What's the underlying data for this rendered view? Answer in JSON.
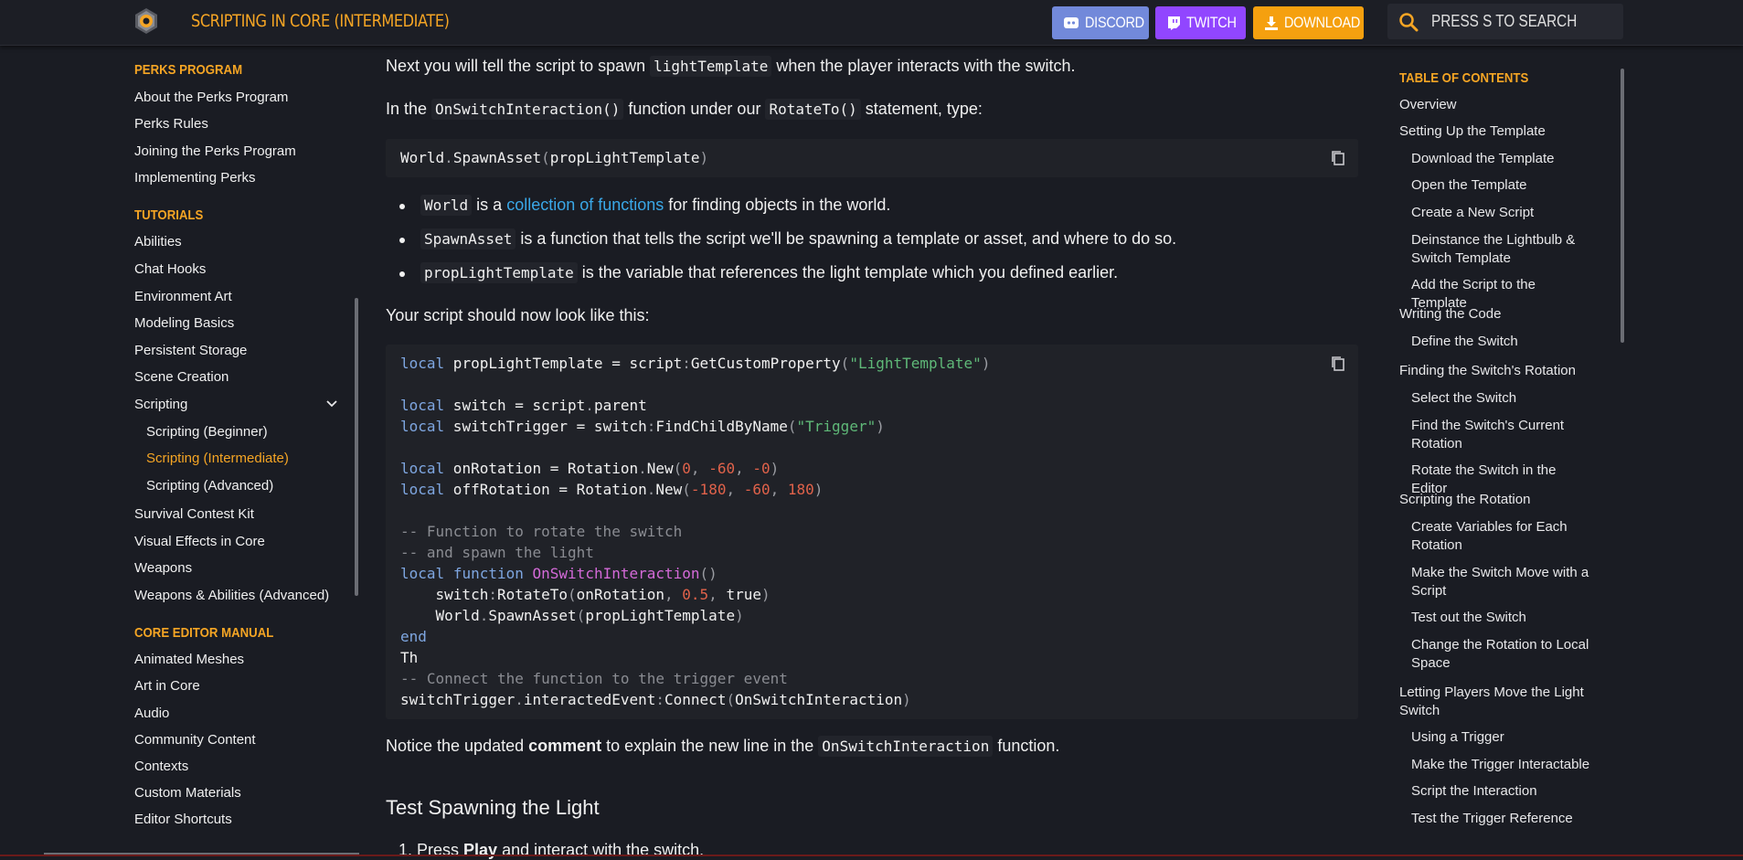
{
  "header": {
    "title": "SCRIPTING IN CORE (INTERMEDIATE)",
    "discord_label": "DISCORD",
    "twitch_label": "TWITCH",
    "download_label": "DOWNLOAD",
    "search_placeholder": "PRESS S TO SEARCH"
  },
  "colors": {
    "accent": "#f5a524",
    "discord": "#7289da",
    "twitch": "#9146ff",
    "download": "#f5a00f",
    "link": "#3aa8e8"
  },
  "sidebar": {
    "perks_heading": "PERKS PROGRAM",
    "perks_items": [
      "About the Perks Program",
      "Perks Rules",
      "Joining the Perks Program",
      "Implementing Perks"
    ],
    "tutorials_heading": "TUTORIALS",
    "tutorials_items": [
      "Abilities",
      "Chat Hooks",
      "Environment Art",
      "Modeling Basics",
      "Persistent Storage",
      "Scene Creation",
      "Scripting"
    ],
    "scripting_sub": [
      "Scripting (Beginner)",
      "Scripting (Intermediate)",
      "Scripting (Advanced)"
    ],
    "tutorials_items_after": [
      "Survival Contest Kit",
      "Visual Effects in Core",
      "Weapons",
      "Weapons & Abilities (Advanced)"
    ],
    "manual_heading": "CORE EDITOR MANUAL",
    "manual_items": [
      "Animated Meshes",
      "Art in Core",
      "Audio",
      "Community Content",
      "Contexts",
      "Custom Materials",
      "Editor Shortcuts"
    ]
  },
  "content": {
    "p1_a": "Next you will tell the script to spawn ",
    "p1_code": "lightTemplate",
    "p1_b": " when the player interacts with the switch.",
    "p2_a": "In the ",
    "p2_code1": "OnSwitchInteraction()",
    "p2_b": " function under our ",
    "p2_code2": "RotateTo()",
    "p2_c": " statement, type:",
    "code1_a": "World",
    "code1_b": ".",
    "code1_c": "SpawnAsset",
    "code1_d": "(",
    "code1_e": "propLightTemplate",
    "code1_f": ")",
    "b1_code": "World",
    "b1_a": " is a ",
    "b1_link": "collection of functions",
    "b1_b": " for finding objects in the world.",
    "b2_code": "SpawnAsset",
    "b2_a": " is a function that tells the script we'll be spawning a template or asset, and where to do so.",
    "b3_code": "propLightTemplate",
    "b3_a": " is the variable that references the light template which you defined earlier.",
    "p3": "Your script should now look like this:",
    "p4_a": "Notice the updated ",
    "p4_bold": "comment",
    "p4_b": " to explain the new line in the ",
    "p4_code": "OnSwitchInteraction",
    "p4_c": " function.",
    "h_test": "Test Spawning the Light",
    "step1_a": "1. Press ",
    "step1_bold": "Play",
    "step1_b": " and interact with the switch."
  },
  "code2": {
    "l1": [
      "local",
      " propLightTemplate = script",
      ":",
      "GetCustomProperty",
      "(",
      "\"LightTemplate\"",
      ")"
    ],
    "l3": [
      "local",
      " switch = script",
      ".",
      "parent"
    ],
    "l4": [
      "local",
      " switchTrigger = switch",
      ":",
      "FindChildByName",
      "(",
      "\"Trigger\"",
      ")"
    ],
    "l6": [
      "local",
      " onRotation = Rotation",
      ".",
      "New",
      "(",
      "0",
      ", ",
      "-60",
      ", ",
      "-0",
      ")"
    ],
    "l7": [
      "local",
      " offRotation = Rotation",
      ".",
      "New",
      "(",
      "-180",
      ", ",
      "-60",
      ", ",
      "180",
      ")"
    ],
    "l9": "-- Function to rotate the switch",
    "l10": "-- and spawn the light",
    "l11": [
      "local",
      " ",
      "function",
      " ",
      "OnSwitchInteraction",
      "()"
    ],
    "l12": [
      "    switch",
      ":",
      "RotateTo",
      "(",
      "onRotation",
      ", ",
      "0.5",
      ", ",
      "true",
      ")"
    ],
    "l13": [
      "    World",
      ".",
      "SpawnAsset",
      "(",
      "propLightTemplate",
      ")"
    ],
    "l14": "end",
    "l15": "Th",
    "l16": "-- Connect the function to the trigger event",
    "l17": [
      "switchTrigger",
      ".",
      "interactedEvent",
      ":",
      "Connect",
      "(",
      "OnSwitchInteraction",
      ")"
    ]
  },
  "toc": {
    "heading": "TABLE OF CONTENTS",
    "items": [
      {
        "label": "Overview",
        "level": 1
      },
      {
        "label": "Setting Up the Template",
        "level": 1
      },
      {
        "label": "Download the Template",
        "level": 2
      },
      {
        "label": "Open the Template",
        "level": 2
      },
      {
        "label": "Create a New Script",
        "level": 2
      },
      {
        "label": "Deinstance the Lightbulb & Switch Template",
        "level": 2
      },
      {
        "label": "Add the Script to the Template",
        "level": 2
      },
      {
        "label": "Writing the Code",
        "level": 1
      },
      {
        "label": "Define the Switch",
        "level": 2
      },
      {
        "label": "Finding the Switch's Rotation",
        "level": 1
      },
      {
        "label": "Select the Switch",
        "level": 2
      },
      {
        "label": "Find the Switch's Current Rotation",
        "level": 2
      },
      {
        "label": "Rotate the Switch in the Editor",
        "level": 2
      },
      {
        "label": "Scripting the Rotation",
        "level": 1
      },
      {
        "label": "Create Variables for Each Rotation",
        "level": 2
      },
      {
        "label": "Make the Switch Move with a Script",
        "level": 2
      },
      {
        "label": "Test out the Switch",
        "level": 2
      },
      {
        "label": "Change the Rotation to Local Space",
        "level": 2
      },
      {
        "label": "Letting Players Move the Light Switch",
        "level": 1
      },
      {
        "label": "Using a Trigger",
        "level": 2
      },
      {
        "label": "Make the Trigger Interactable",
        "level": 2
      },
      {
        "label": "Script the Interaction",
        "level": 2
      },
      {
        "label": "Test the Trigger Reference",
        "level": 2
      }
    ]
  }
}
